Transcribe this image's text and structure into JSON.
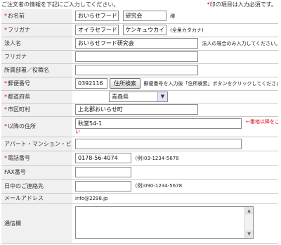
{
  "header": {
    "intro": "ご注文者の情報を下記にご入力してください。",
    "required_mark": "*",
    "required_note": "印の項目は入力必須です。"
  },
  "rows": {
    "name": {
      "label": "お名前",
      "required": true,
      "last": "おいらせフード",
      "first": "研究会",
      "suffix": "様"
    },
    "furigana_req": {
      "label": "フリガナ",
      "required": true,
      "last": "オイラセフード",
      "first": "ケンキュウカイ",
      "hint": "(全角カタカナ)"
    },
    "corp": {
      "label": "法人名",
      "required": false,
      "value": "おいらせフード研究会",
      "hint": "法人の場合のみ入力してください。"
    },
    "furigana": {
      "label": "フリガナ",
      "required": false,
      "value": ""
    },
    "dept": {
      "label": "所属部署／役職名",
      "required": false,
      "value": ""
    },
    "postal": {
      "label": "郵便番号",
      "required": true,
      "value": "0392116",
      "button": "住所検索",
      "hint": "郵便番号を入力後「住所検索」ボタンをクリックしてください。"
    },
    "pref": {
      "label": "都道府県",
      "required": true,
      "value": "青森県",
      "arrow": "▼"
    },
    "city": {
      "label": "市区町村",
      "required": true,
      "value": "上北郡おいらせ町"
    },
    "address": {
      "label": "以降の住所",
      "required": true,
      "value": "秋堂54-1",
      "note": "←番地以降をご入力ください",
      "note_line1": "←番地以降をご入力くださ",
      "note_line2": "い"
    },
    "building": {
      "label": "アパート・マンション・ビル",
      "required": false,
      "value": ""
    },
    "phone": {
      "label": "電話番号",
      "required": true,
      "value": "0178-56-4074",
      "hint": "(例)03-1234-5678"
    },
    "fax": {
      "label": "FAX番号",
      "required": false,
      "value": ""
    },
    "daytime": {
      "label": "日中のご連絡先",
      "required": false,
      "value": "",
      "hint": "(例)090-1234-5678"
    },
    "email": {
      "label": "メールアドレス",
      "required": false,
      "value": "info@2298.jp"
    },
    "message": {
      "label": "通信欄",
      "required": false,
      "value": ""
    }
  },
  "colors": {
    "required": "#e0001a",
    "label_bg": "#f0f0f0",
    "border": "#c9c9c9"
  }
}
